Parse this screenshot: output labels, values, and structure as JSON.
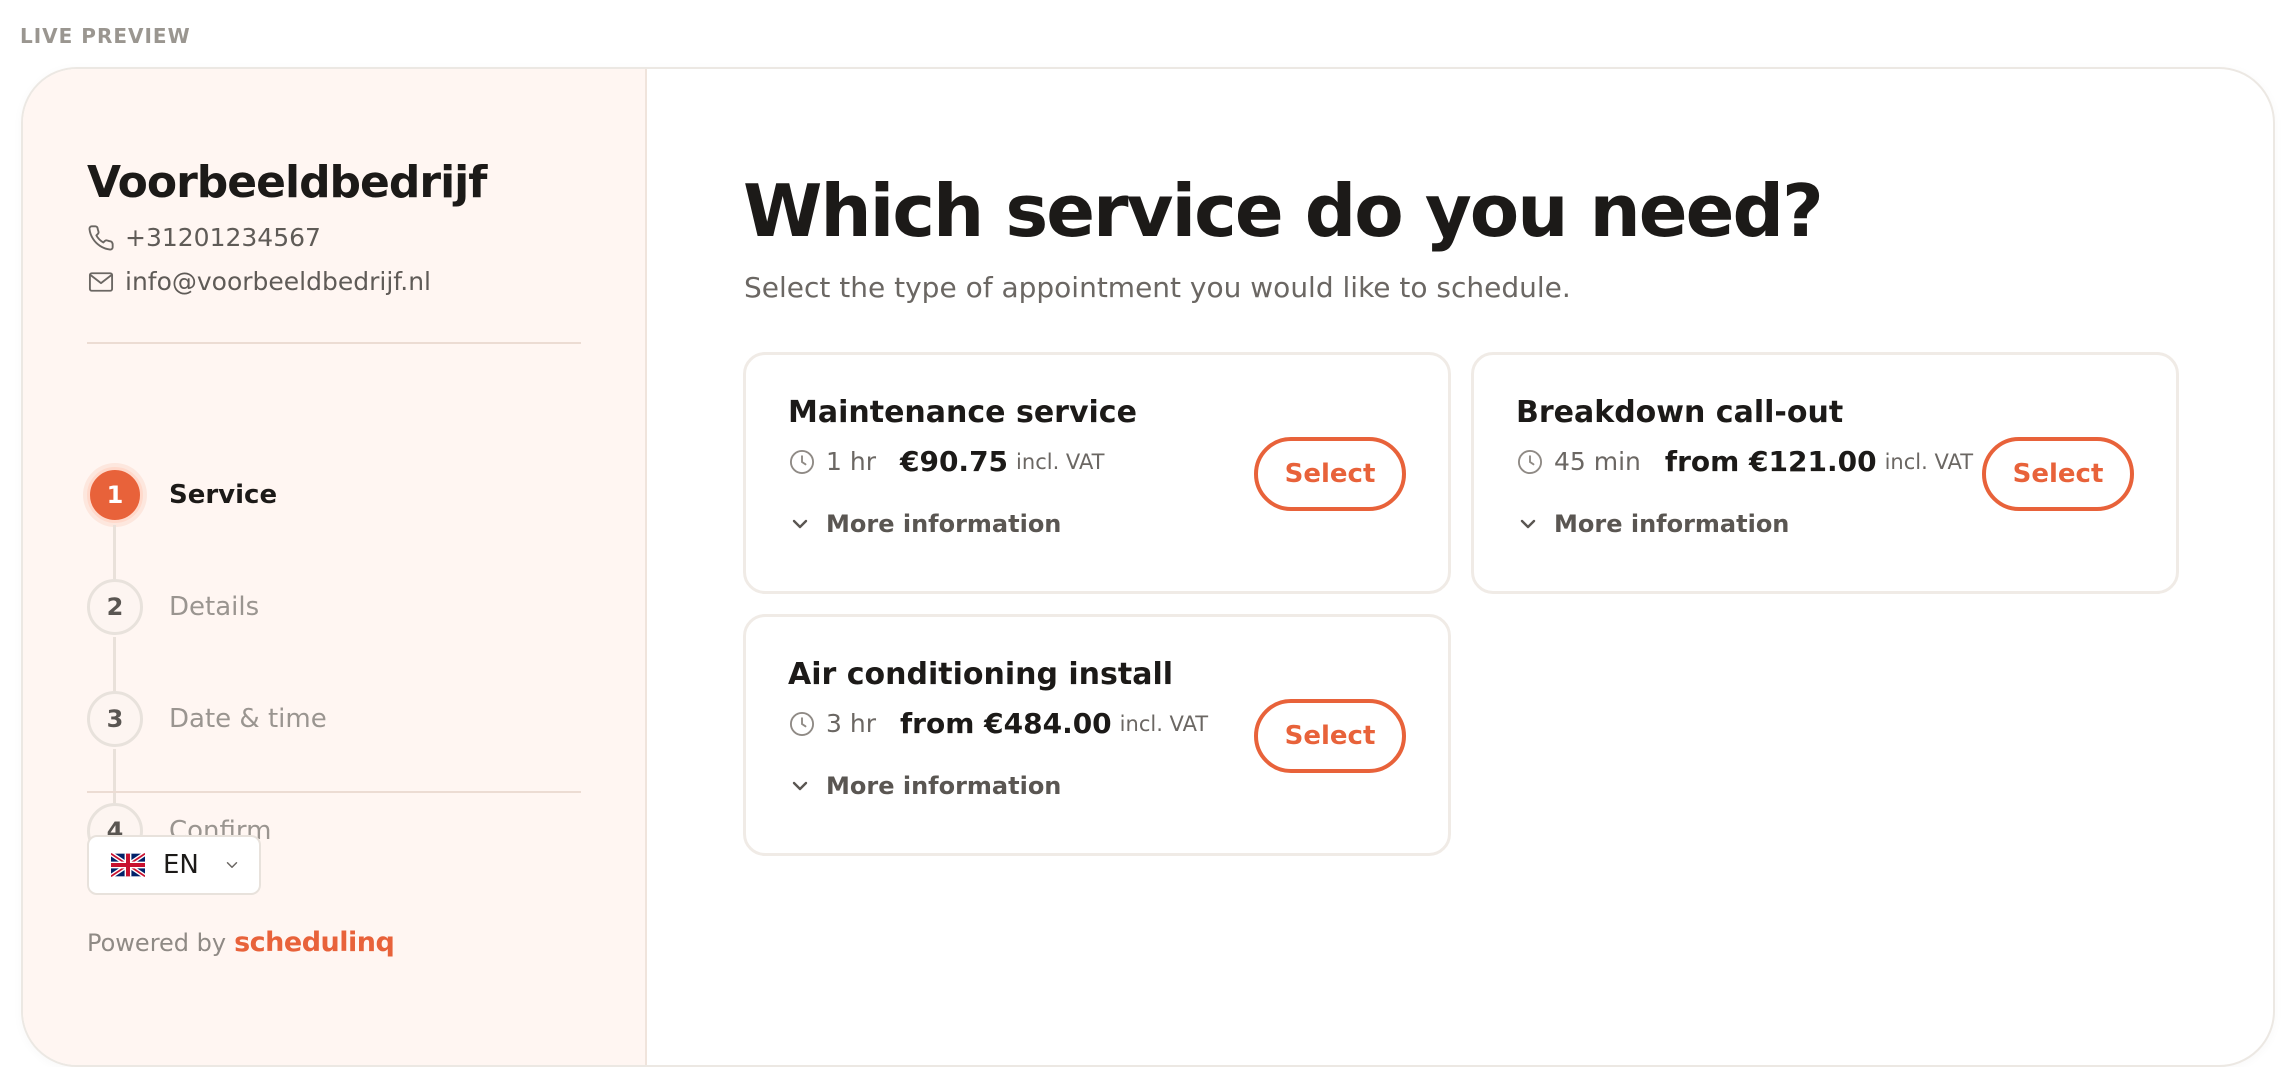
{
  "preview_label": "LIVE PREVIEW",
  "sidebar": {
    "company_name": "Voorbeeldbedrijf",
    "phone": "+31201234567",
    "email": "info@voorbeeldbedrijf.nl",
    "steps": [
      {
        "number": "1",
        "label": "Service",
        "active": true
      },
      {
        "number": "2",
        "label": "Details",
        "active": false
      },
      {
        "number": "3",
        "label": "Date & time",
        "active": false
      },
      {
        "number": "4",
        "label": "Confirm",
        "active": false
      }
    ],
    "language": {
      "code": "EN",
      "flag_icon": "uk-flag-icon"
    },
    "powered_by": {
      "text": "Powered by",
      "brand": "schedulinq"
    }
  },
  "main": {
    "title": "Which service do you need?",
    "subtitle": "Select the type of appointment you would like to schedule.",
    "services": [
      {
        "name": "Maintenance service",
        "duration": "1 hr",
        "price": "€90.75",
        "vat": "incl. VAT",
        "more_info": "More information",
        "select_label": "Select"
      },
      {
        "name": "Breakdown call-out",
        "duration": "45 min",
        "price": "from €121.00",
        "vat": "incl. VAT",
        "more_info": "More information",
        "select_label": "Select"
      },
      {
        "name": "Air conditioning install",
        "duration": "3 hr",
        "price": "from €484.00",
        "vat": "incl. VAT",
        "more_info": "More information",
        "select_label": "Select"
      }
    ]
  },
  "colors": {
    "accent": "#e8623a",
    "sidebar_bg": "#fff6f2",
    "text_dark": "#1c1a18",
    "text_muted": "#6b6763"
  }
}
